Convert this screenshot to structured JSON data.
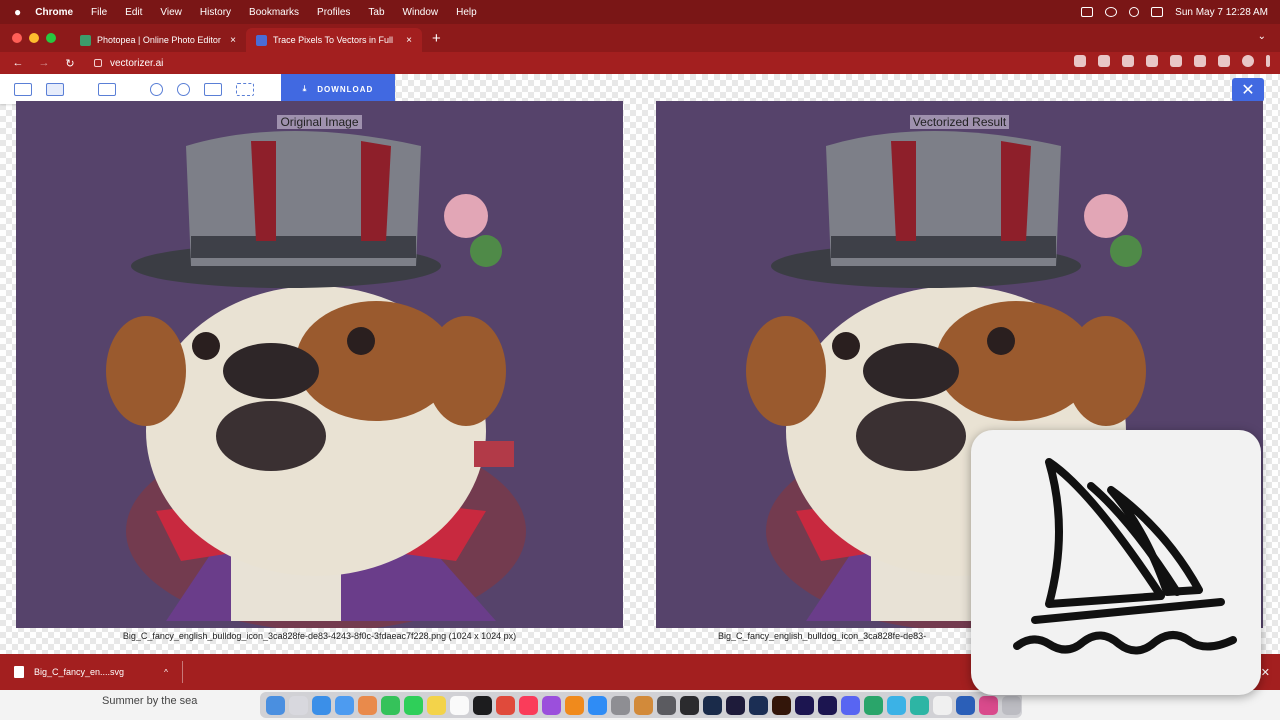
{
  "menubar": {
    "app": "Chrome",
    "items": [
      "File",
      "Edit",
      "View",
      "History",
      "Bookmarks",
      "Profiles",
      "Tab",
      "Window",
      "Help"
    ],
    "clock": "Sun May 7  12:28 AM"
  },
  "tabs": [
    {
      "label": "Photopea | Online Photo Editor",
      "close": "×"
    },
    {
      "label": "Trace Pixels To Vectors in Full",
      "close": "×"
    }
  ],
  "newtab": "+",
  "tabmenu": "⌄",
  "address": {
    "back": "←",
    "forward": "→",
    "reload": "↻",
    "url": "vectorizer.ai"
  },
  "toolbar": {
    "download_label": "DOWNLOAD",
    "close": "✕"
  },
  "left_panel": {
    "title": "Original Image",
    "caption": "Big_C_fancy_english_bulldog_icon_3ca828fe-de83-4243-8f0c-3fdaeac7f228.png (1024 x 1024 px)"
  },
  "right_panel": {
    "title": "Vectorized Result",
    "caption": "Big_C_fancy_english_bulldog_icon_3ca828fe-de83-"
  },
  "downloads": {
    "filename": "Big_C_fancy_en....svg",
    "caret": "^",
    "close": "✕"
  },
  "dock": {
    "background_text": "Summer by the sea"
  },
  "colors": {
    "menubar": "#7a1616",
    "chrome": "#a31f1f",
    "accent": "#4169e1",
    "canvas": "#56436b"
  }
}
